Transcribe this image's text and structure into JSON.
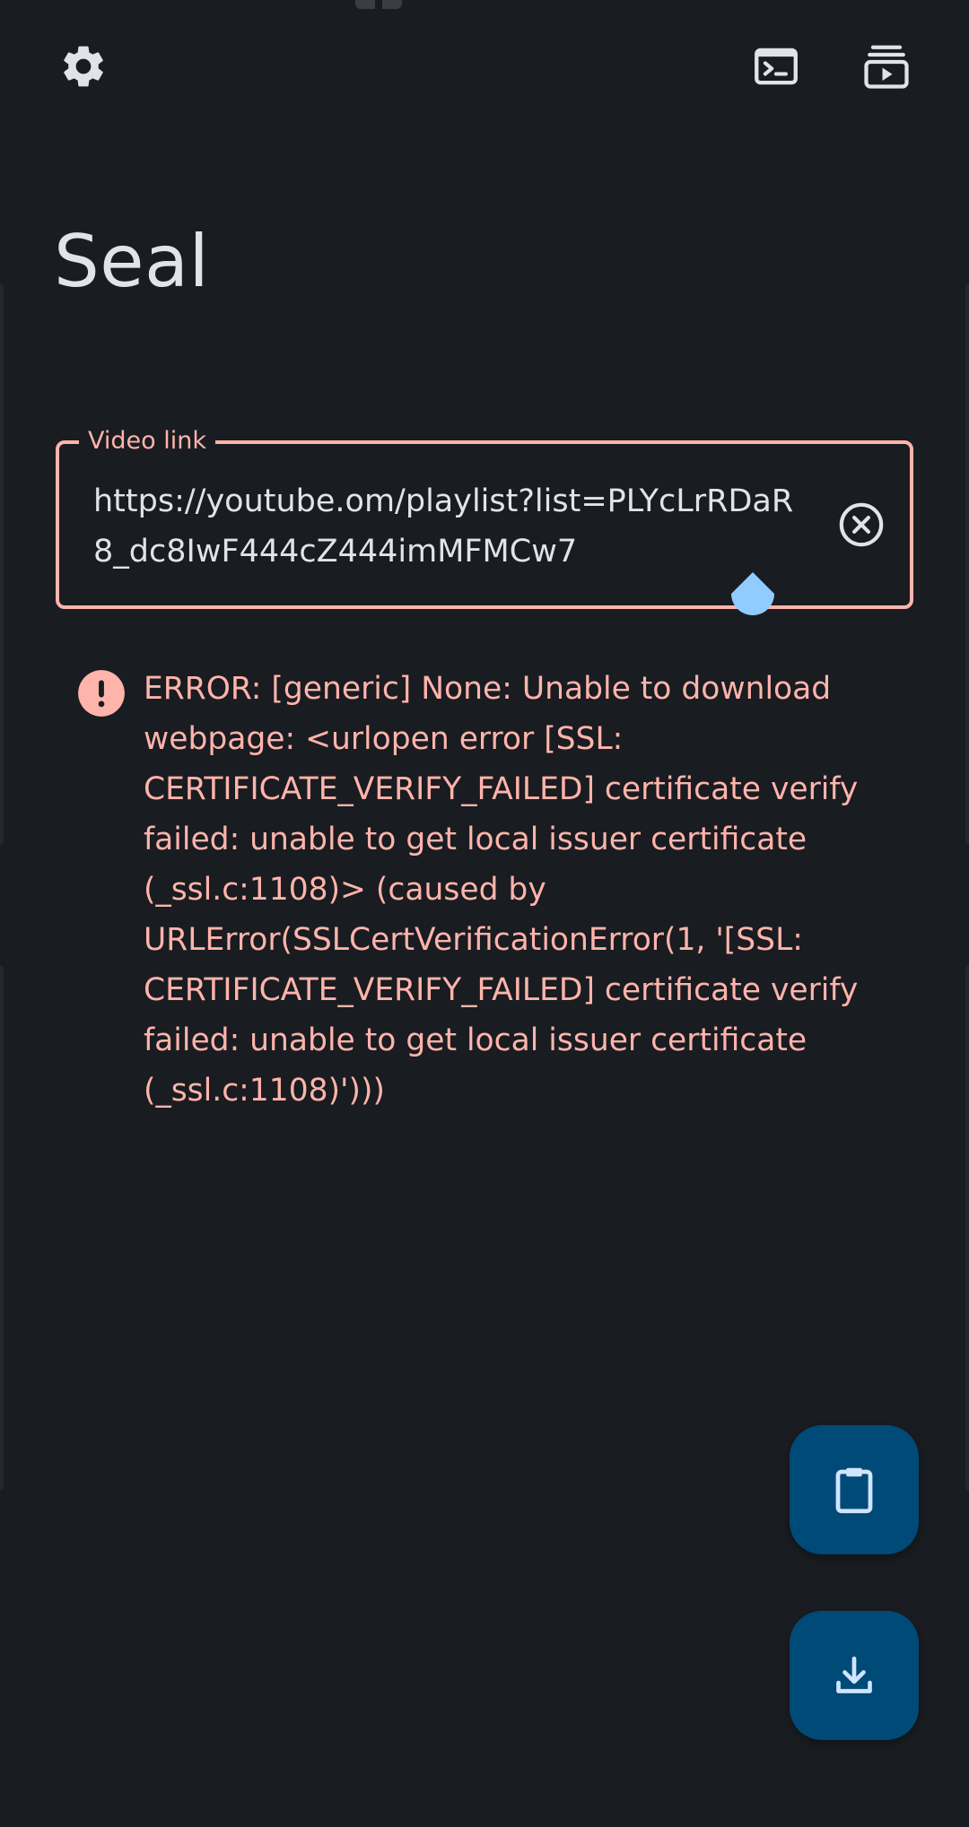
{
  "app": {
    "title": "Seal"
  },
  "toolbar": {
    "left_icon": "settings-gear-icon",
    "right_icons": [
      "terminal-icon",
      "video-library-icon"
    ]
  },
  "url_field": {
    "label": "Video link",
    "value": "https://youtube.om/playlist?list=PLYcLrRDaR8_dc8IwF444cZ444imMFMCw7",
    "clear_icon": "clear-circle-icon"
  },
  "error": {
    "icon": "error-exclamation-icon",
    "message": "ERROR: [generic] None: Unable to download webpage: <urlopen error [SSL: CERTIFICATE_VERIFY_FAILED] certificate verify failed: unable to get local issuer certificate (_ssl.c:1108)> (caused by URLError(SSLCertVerificationError(1, '[SSL: CERTIFICATE_VERIFY_FAILED] certificate verify failed: unable to get local issuer certificate (_ssl.c:1108)')))"
  },
  "fabs": {
    "paste_icon": "clipboard-icon",
    "download_icon": "download-icon"
  },
  "colors": {
    "background": "#191c21",
    "error": "#ffb4ab",
    "fab": "#004a77",
    "fab_icon": "#cfe5ff",
    "handle": "#90ccff",
    "on_surface": "#e2e2e9"
  }
}
